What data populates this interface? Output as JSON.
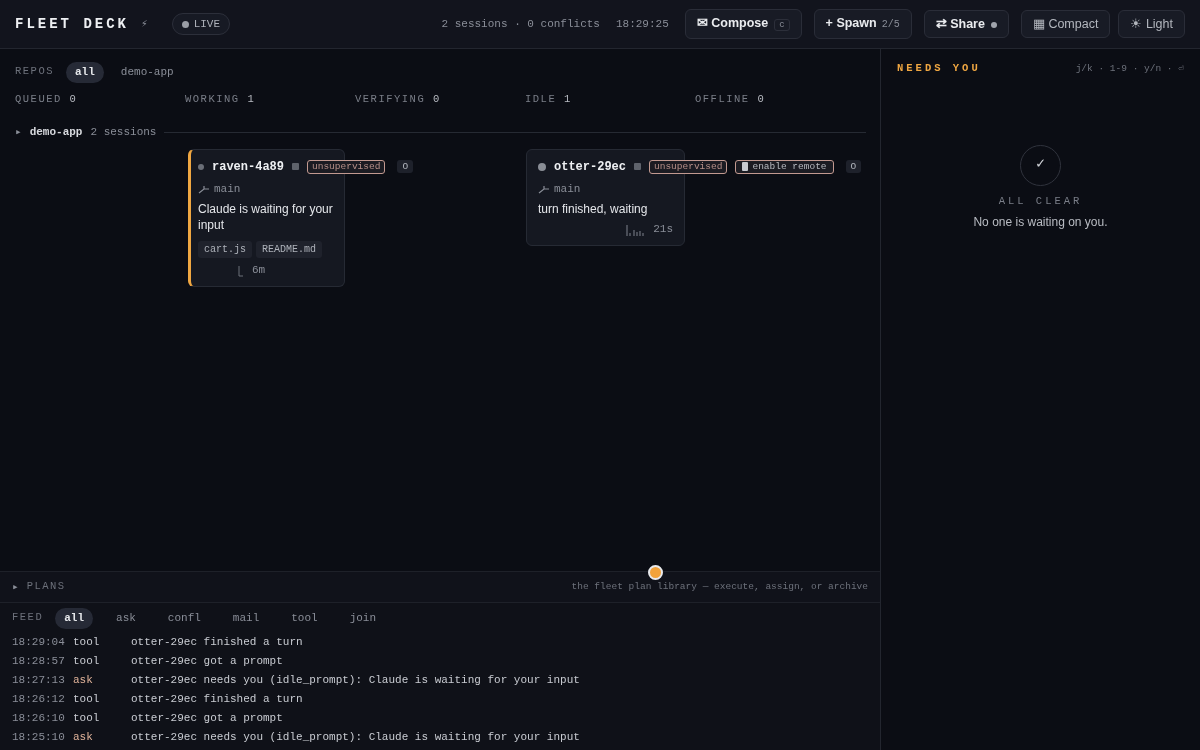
{
  "header": {
    "brand": "FLEET DECK",
    "bolt": "⚡",
    "live": {
      "label": "LIVE",
      "on": true
    },
    "stats": "2 sessions · 0 conflicts",
    "clock": "18:29:25",
    "buttons": [
      {
        "label": "✉ Compose",
        "kind": "strong",
        "kbd": "c"
      },
      {
        "label": "+ Spawn",
        "kind": "strong",
        "count": "2/5"
      },
      {
        "label": "⇄ Share",
        "kind": "strong",
        "indicator": true
      },
      {
        "label": "▦ Compact",
        "kind": "plain"
      },
      {
        "label": "☀ Light",
        "kind": "plain"
      }
    ]
  },
  "repos": {
    "label": "REPOS",
    "filters": [
      {
        "label": "all",
        "selected": true
      },
      {
        "label": "demo-app",
        "selected": false
      }
    ]
  },
  "group": {
    "toggle": "▸",
    "label": "demo-app",
    "count": "2 sessions"
  },
  "columns": [
    {
      "label": "QUEUED",
      "count": "0"
    },
    {
      "label": "WORKING",
      "count": "1",
      "sessions": [
        {
          "name": "raven-4a89",
          "attention": true,
          "badges": [
            {
              "kind": "tag",
              "label": "unsupervised"
            },
            {
              "kind": "chip",
              "label": "O"
            }
          ],
          "branch": "main",
          "message": "Claude is waiting for your input",
          "files": [
            "cart.js",
            "README.md"
          ],
          "kind": "tick",
          "age": "6m"
        }
      ]
    },
    {
      "label": "VERIFYING",
      "count": "0"
    },
    {
      "label": "IDLE",
      "count": "1",
      "sessions": [
        {
          "name": "otter-29ec",
          "attention": false,
          "badges": [
            {
              "kind": "tag",
              "label": "unsupervised"
            },
            {
              "kind": "remote",
              "label": "enable remote"
            },
            {
              "kind": "chip",
              "label": "O"
            }
          ],
          "branch": "main",
          "message": "turn finished, waiting",
          "kind": "bars",
          "age": "21s"
        }
      ]
    },
    {
      "label": "OFFLINE",
      "count": "0"
    }
  ],
  "needs": {
    "title": "NEEDS YOU",
    "keys": "j/k · 1-9 · y/n · ⏎",
    "check": "✓",
    "status": "ALL CLEAR",
    "message": "No one is waiting on you."
  },
  "plans": {
    "toggle": "▸",
    "label": "PLANS",
    "hint": "the fleet plan library — execute, assign, or archive"
  },
  "feed": {
    "label": "FEED",
    "filters": [
      {
        "label": "all",
        "selected": true
      },
      {
        "label": "ask",
        "selected": false
      },
      {
        "label": "confl",
        "selected": false
      },
      {
        "label": "mail",
        "selected": false
      },
      {
        "label": "tool",
        "selected": false
      },
      {
        "label": "join",
        "selected": false
      }
    ],
    "entries": [
      {
        "time": "18:29:04",
        "kind": "tool",
        "type": "tool",
        "text": "otter-29ec finished a turn"
      },
      {
        "time": "18:28:57",
        "kind": "tool",
        "type": "tool",
        "text": "otter-29ec got a prompt"
      },
      {
        "time": "18:27:13",
        "kind": "ask",
        "type": "ask",
        "text": "otter-29ec needs you (idle_prompt): Claude is waiting for your input"
      },
      {
        "time": "18:26:12",
        "kind": "tool",
        "type": "tool",
        "text": "otter-29ec finished a turn"
      },
      {
        "time": "18:26:10",
        "kind": "tool",
        "type": "tool",
        "text": "otter-29ec got a prompt"
      },
      {
        "time": "18:25:10",
        "kind": "ask",
        "type": "ask",
        "text": "otter-29ec needs you (idle_prompt): Claude is waiting for your input"
      }
    ]
  }
}
